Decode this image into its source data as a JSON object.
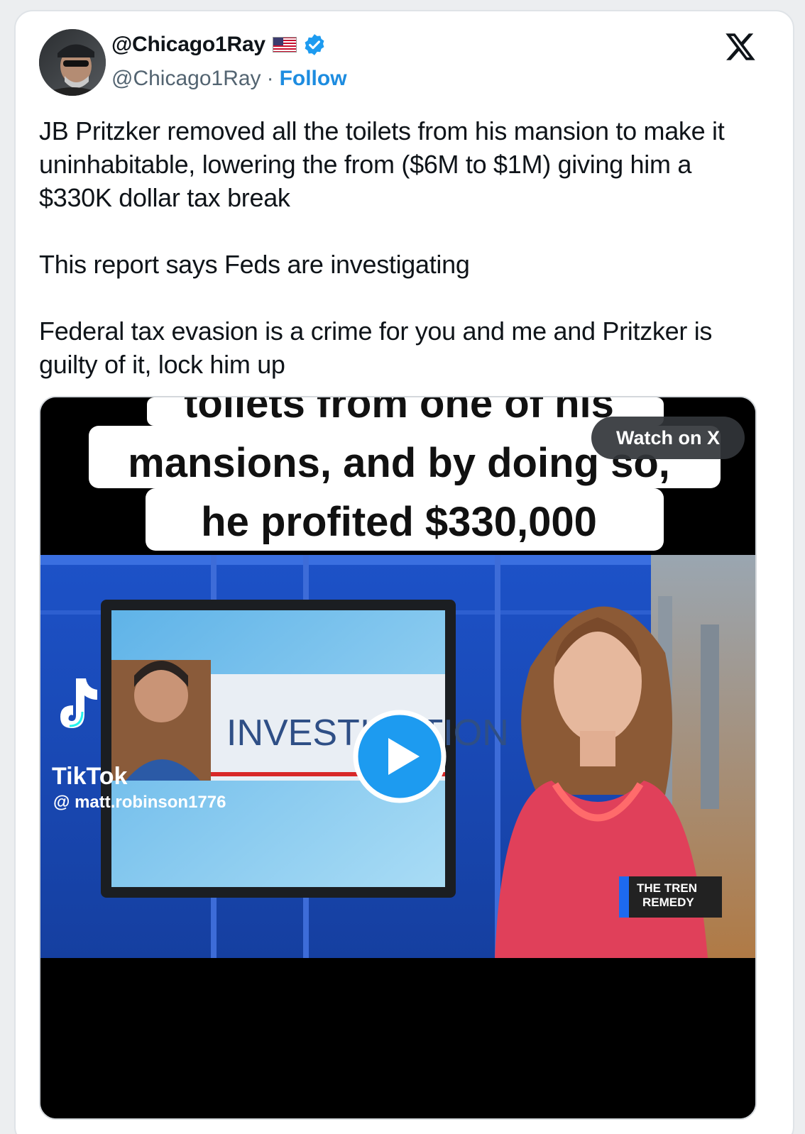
{
  "author": {
    "display_name": "@Chicago1Ray",
    "handle": "@Chicago1Ray",
    "separator": "·",
    "follow_label": "Follow"
  },
  "icons": {
    "flag": "us-flag-icon",
    "verified": "verified-badge-icon",
    "brand": "x-logo-icon",
    "play": "play-icon",
    "tiktok": "tiktok-icon"
  },
  "tweet": {
    "paragraphs": [
      "JB Pritzker removed all the toilets from his mansion to make it uninhabitable, lowering the from ($6M to $1M) giving him a $330K dollar tax break",
      "This report says Feds are investigating",
      "Federal tax evasion is a crime for you and me and Pritzker is guilty of it, lock him up"
    ]
  },
  "video": {
    "watch_label": "Watch on X",
    "caption_lines": [
      "toilets from one of his",
      "mansions, and by doing so,",
      "he profited $330,000"
    ],
    "screen_text": "INVESTIGATION",
    "tiktok_label": "TikTok",
    "tiktok_user": "@ matt.robinson1776",
    "lower_third_lines": [
      "THE TREN",
      "REMEDY"
    ]
  },
  "colors": {
    "link_blue": "#1d8ce0",
    "verified_blue": "#1d9bf0",
    "text": "#0f1419",
    "muted": "#536471"
  }
}
